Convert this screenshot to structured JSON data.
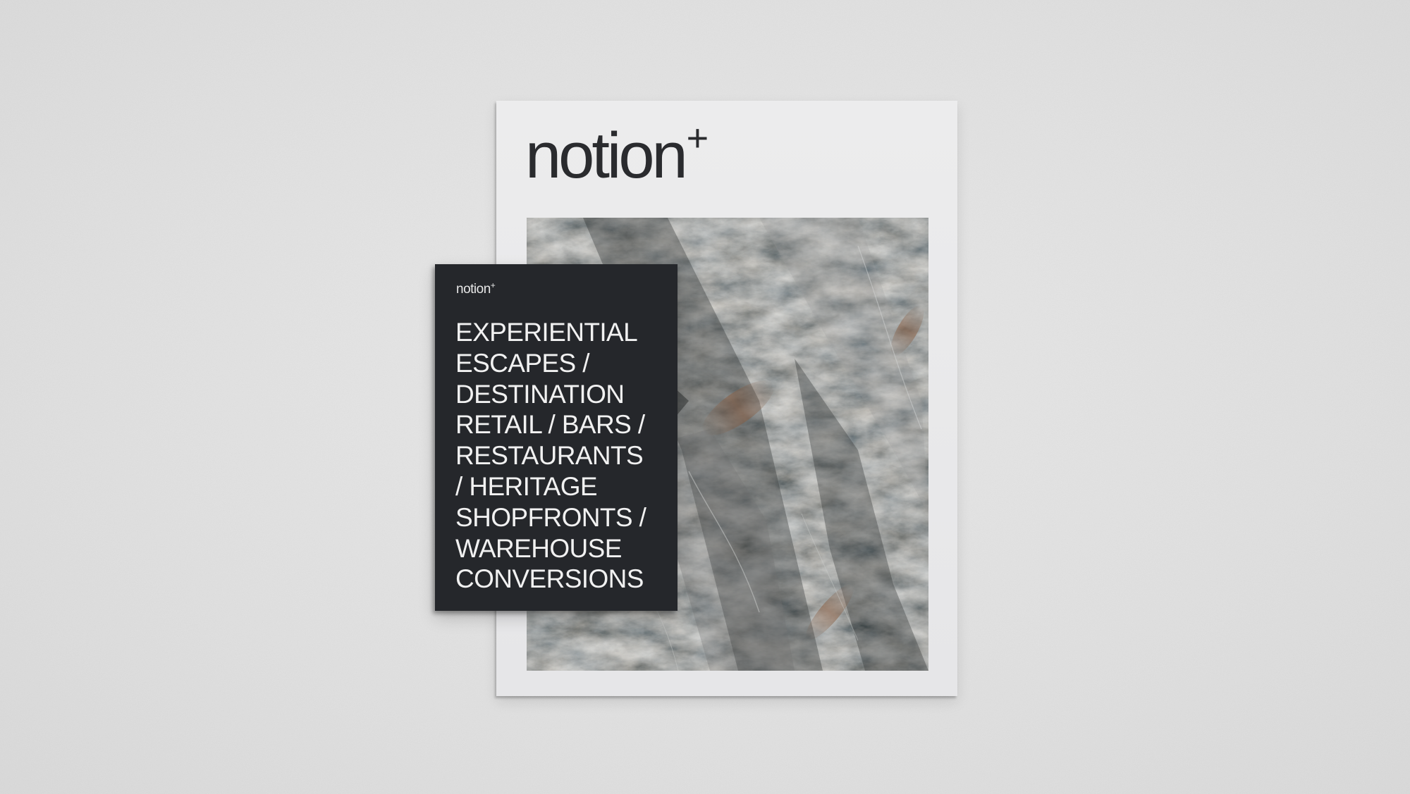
{
  "scene": {
    "background_color": "#e4e4e4",
    "sheet_color": "#e9e9eb",
    "card_color": "#25272b",
    "text_dark": "#2a2b2e",
    "text_light": "#f1f1f1"
  },
  "sheet": {
    "logo_word": "notion",
    "logo_mark": "+",
    "photo_icon": "rock-texture-image"
  },
  "card": {
    "logo_word": "notion",
    "logo_mark": "+",
    "lines": [
      "EXPERIENTIAL",
      "ESCAPES /",
      "DESTINATION",
      "RETAIL / BARS /",
      "RESTAURANTS",
      "/ HERITAGE",
      "SHOPFRONTS /",
      "WAREHOUSE",
      "CONVERSIONS"
    ]
  }
}
